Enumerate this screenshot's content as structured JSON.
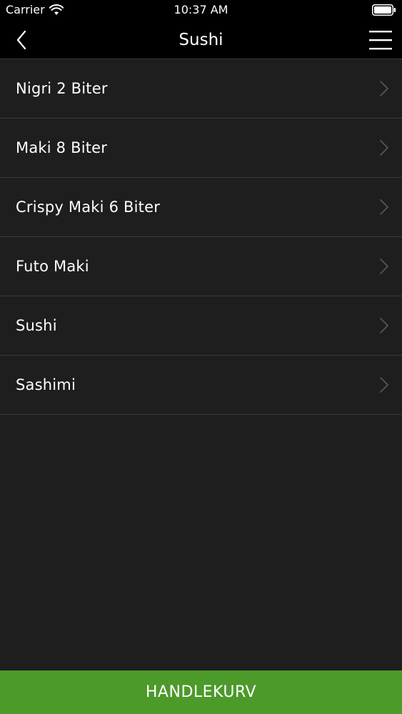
{
  "status_bar": {
    "carrier": "Carrier",
    "time": "10:37 AM",
    "wifi_icon": "wifi-icon",
    "battery_icon": "battery-icon"
  },
  "nav": {
    "title": "Sushi",
    "back_icon": "chevron-left-icon",
    "menu_icon": "hamburger-menu-icon"
  },
  "items": [
    {
      "label": "Nigri 2 Biter"
    },
    {
      "label": "Maki 8 Biter"
    },
    {
      "label": "Crispy Maki 6 Biter"
    },
    {
      "label": "Futo Maki"
    },
    {
      "label": "Sushi"
    },
    {
      "label": "Sashimi"
    }
  ],
  "cart": {
    "label": "HANDLEKURV"
  },
  "colors": {
    "background": "#1e1e1f",
    "bar_black": "#000000",
    "divider": "#3a3a3c",
    "cart_green": "#4c9a2a",
    "chevron": "#555558"
  }
}
